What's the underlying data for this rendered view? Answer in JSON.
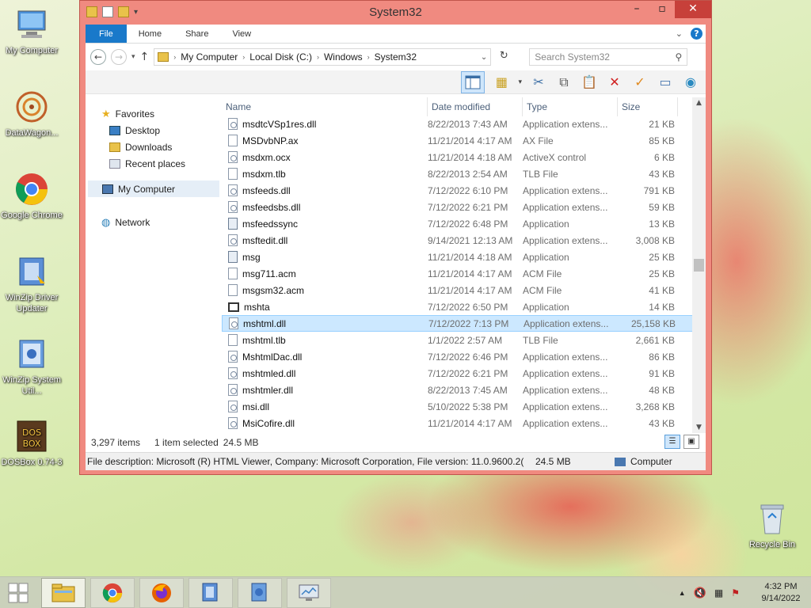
{
  "desktop": {
    "icons": [
      {
        "label": "My Computer"
      },
      {
        "label": "DataWagon..."
      },
      {
        "label": "Google Chrome"
      },
      {
        "label": "WinZip Driver Updater"
      },
      {
        "label": "WinZip System Util..."
      },
      {
        "label": "DOSBox 0.74-3"
      },
      {
        "label": "Recycle Bin"
      }
    ]
  },
  "window": {
    "title": "System32",
    "ribbon_tabs": [
      "File",
      "Home",
      "Share",
      "View"
    ],
    "address": {
      "crumbs": [
        "My Computer",
        "Local Disk (C:)",
        "Windows",
        "System32"
      ]
    },
    "search": {
      "placeholder": "Search System32"
    },
    "nav": {
      "favorites": "Favorites",
      "desktop": "Desktop",
      "downloads": "Downloads",
      "recent": "Recent places",
      "computer": "My Computer",
      "network": "Network"
    },
    "columns": {
      "name": "Name",
      "date": "Date modified",
      "type": "Type",
      "size": "Size"
    },
    "files": [
      {
        "name": "msdtcVSp1res.dll",
        "date": "8/22/2013 7:43 AM",
        "type": "Application extens...",
        "size": "21 KB",
        "icon": "dll"
      },
      {
        "name": "MSDvbNP.ax",
        "date": "11/21/2014 4:17 AM",
        "type": "AX File",
        "size": "85 KB",
        "icon": "file"
      },
      {
        "name": "msdxm.ocx",
        "date": "11/21/2014 4:18 AM",
        "type": "ActiveX control",
        "size": "6 KB",
        "icon": "dll"
      },
      {
        "name": "msdxm.tlb",
        "date": "8/22/2013 2:54 AM",
        "type": "TLB File",
        "size": "43 KB",
        "icon": "file"
      },
      {
        "name": "msfeeds.dll",
        "date": "7/12/2022 6:10 PM",
        "type": "Application extens...",
        "size": "791 KB",
        "icon": "dll"
      },
      {
        "name": "msfeedsbs.dll",
        "date": "7/12/2022 6:21 PM",
        "type": "Application extens...",
        "size": "59 KB",
        "icon": "dll"
      },
      {
        "name": "msfeedssync",
        "date": "7/12/2022 6:48 PM",
        "type": "Application",
        "size": "13 KB",
        "icon": "app"
      },
      {
        "name": "msftedit.dll",
        "date": "9/14/2021 12:13 AM",
        "type": "Application extens...",
        "size": "3,008 KB",
        "icon": "dll"
      },
      {
        "name": "msg",
        "date": "11/21/2014 4:18 AM",
        "type": "Application",
        "size": "25 KB",
        "icon": "app"
      },
      {
        "name": "msg711.acm",
        "date": "11/21/2014 4:17 AM",
        "type": "ACM File",
        "size": "25 KB",
        "icon": "file"
      },
      {
        "name": "msgsm32.acm",
        "date": "11/21/2014 4:17 AM",
        "type": "ACM File",
        "size": "41 KB",
        "icon": "file"
      },
      {
        "name": "mshta",
        "date": "7/12/2022 6:50 PM",
        "type": "Application",
        "size": "14 KB",
        "icon": "win"
      },
      {
        "name": "mshtml.dll",
        "date": "7/12/2022 7:13 PM",
        "type": "Application extens...",
        "size": "25,158 KB",
        "icon": "dll",
        "selected": true
      },
      {
        "name": "mshtml.tlb",
        "date": "1/1/2022 2:57 AM",
        "type": "TLB File",
        "size": "2,661 KB",
        "icon": "file"
      },
      {
        "name": "MshtmlDac.dll",
        "date": "7/12/2022 6:46 PM",
        "type": "Application extens...",
        "size": "86 KB",
        "icon": "dll"
      },
      {
        "name": "mshtmled.dll",
        "date": "7/12/2022 6:21 PM",
        "type": "Application extens...",
        "size": "91 KB",
        "icon": "dll"
      },
      {
        "name": "mshtmler.dll",
        "date": "8/22/2013 7:45 AM",
        "type": "Application extens...",
        "size": "48 KB",
        "icon": "dll"
      },
      {
        "name": "msi.dll",
        "date": "5/10/2022 5:38 PM",
        "type": "Application extens...",
        "size": "3,268 KB",
        "icon": "dll"
      },
      {
        "name": "MsiCofire.dll",
        "date": "11/21/2014 4:17 AM",
        "type": "Application extens...",
        "size": "43 KB",
        "icon": "dll"
      }
    ],
    "status": {
      "items": "3,297 items",
      "selected": "1 item selected",
      "size": "24.5 MB"
    },
    "details": {
      "description": "File description: Microsoft (R) HTML Viewer, Company: Microsoft Corporation, File version: 11.0.9600.2(",
      "size": "24.5 MB",
      "location": "Computer"
    }
  },
  "taskbar": {
    "clock_time": "4:32 PM",
    "clock_date": "9/14/2022"
  },
  "colors": {
    "accent": "#1979ca",
    "window_frame": "#f08a80",
    "selection": "#cce8ff"
  }
}
